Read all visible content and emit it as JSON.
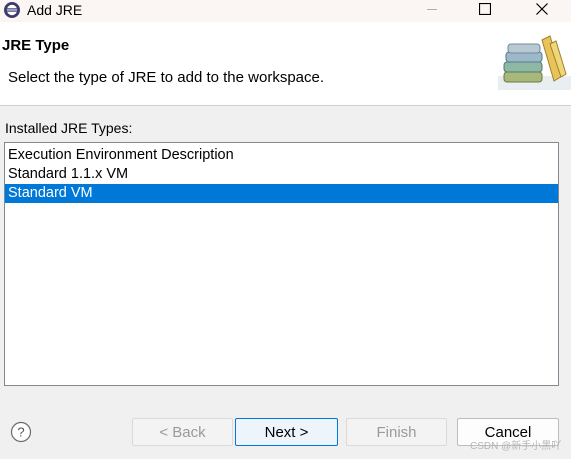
{
  "window": {
    "title": "Add JRE",
    "minimize_icon": "minimize-icon",
    "maximize_icon": "maximize-icon",
    "close_icon": "close-icon"
  },
  "banner": {
    "title": "JRE Type",
    "description": "Select the type of JRE to add to the workspace.",
    "image_icon": "books-icon"
  },
  "jre_types": {
    "label": "Installed JRE Types:",
    "items": [
      {
        "label": "Execution Environment Description",
        "selected": false
      },
      {
        "label": "Standard 1.1.x VM",
        "selected": false
      },
      {
        "label": "Standard VM",
        "selected": true
      }
    ]
  },
  "buttons": {
    "help_icon": "help-icon",
    "back": "< Back",
    "next": "Next >",
    "finish": "Finish",
    "cancel": "Cancel"
  },
  "watermark": "CSDN @新手小黑吖",
  "colors": {
    "selection": "#0078d7",
    "banner_bg": "#ffffff",
    "dialog_bg": "#f0f0f0"
  }
}
